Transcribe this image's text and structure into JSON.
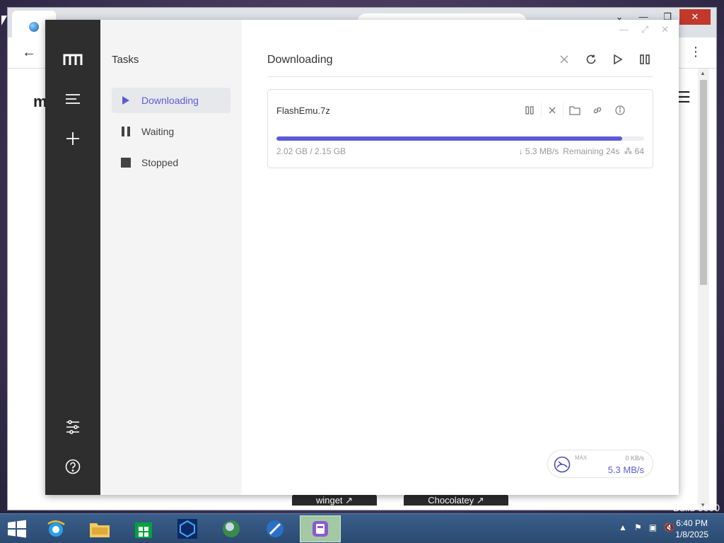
{
  "background_browser": {
    "tab_char": "",
    "build_text": "Build 9600",
    "pills": {
      "winget": "winget  ↗",
      "chocolatey": "Chocolatey  ↗"
    }
  },
  "sidebar": {
    "title": "Tasks",
    "items": [
      {
        "label": "Downloading",
        "icon": "play-icon",
        "active": true
      },
      {
        "label": "Waiting",
        "icon": "pause-icon",
        "active": false
      },
      {
        "label": "Stopped",
        "icon": "stop-icon",
        "active": false
      }
    ]
  },
  "main": {
    "title": "Downloading",
    "actions": [
      "close-icon",
      "refresh-icon",
      "play-icon",
      "pause-all-icon"
    ]
  },
  "task": {
    "name": "FlashEmu.7z",
    "size_text": "2.02 GB / 2.15 GB",
    "progress_percent": 94,
    "speed": "↓ 5.3 MB/s",
    "remaining": "Remaining 24s",
    "connections": "⁂ 64"
  },
  "speed_widget": {
    "max_label": "MAX",
    "upload": "0 KB/s",
    "download": "5.3 MB/s"
  },
  "taskbar": {
    "time": "6:40 PM",
    "date": "1/8/2025"
  },
  "colors": {
    "accent": "#5b5bd6",
    "rail": "#2e2e2e",
    "sidebar": "#f4f4f5"
  }
}
